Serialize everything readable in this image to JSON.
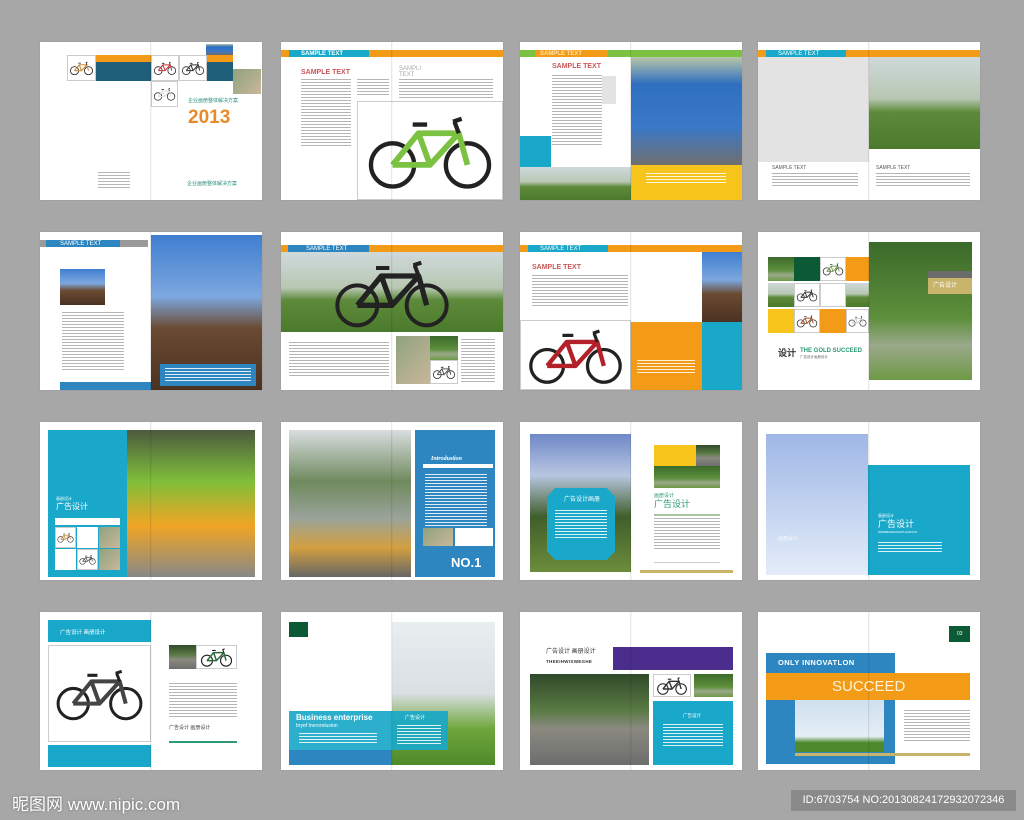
{
  "colors": {
    "cyan": "#19a8c9",
    "orange": "#f39b17",
    "blue": "#2d86c0",
    "green": "#0b5a35",
    "yellow": "#f7c41c",
    "purple": "#4b2d8d",
    "tan": "#c9b46c",
    "background": "#a7a7a7"
  },
  "spreads": [
    {
      "title_cn": "企业画册整体解决方案",
      "year": "2013",
      "footer_cn": "企业画册整体解决方案"
    },
    {
      "tab": "SAMPLE TEXT",
      "heading": "SAMPLE TEXT",
      "heading_right": "SAMPLI TEXT"
    },
    {
      "tab": "SAMPLE TEXT",
      "heading": "SAMPLE TEXT"
    },
    {
      "tab": "SAMPLE TEXT",
      "caption_left": "SAMPLE TEXT",
      "caption_right": "SAMPLE TEXT"
    },
    {
      "tab": "SAMPLE TEXT"
    },
    {
      "tab": "SAMPLE TEXT"
    },
    {
      "tab": "SAMPLE TEXT",
      "heading": "SAMPLE TEXT"
    },
    {
      "title_cn": "设计",
      "title_en": "THE GOLD SUCCEED",
      "subtitle_cn": "广告设计画册设计",
      "label_cn": "广告设计"
    },
    {
      "small_cn": "画册设计",
      "title_cn": "广告设计"
    },
    {
      "heading": "Introdustion",
      "number": "NO.1"
    },
    {
      "box_title": "广告设计画册",
      "small_cn": "画册设计",
      "title_cn": "广告设计"
    },
    {
      "small_cn": "画册设计",
      "title_cn": "广告设计",
      "subtitle_en": "WENBENWAISHITUANXIAN",
      "overlay_cn": "画册设计"
    },
    {
      "header_cn": "广告设计 画册设计",
      "caption_cn": "广告设计 画册设计"
    },
    {
      "title_en": "Business enterprise",
      "subtitle_en": "bryef Ineroreluston",
      "label_cn": "广告设计"
    },
    {
      "title_cn": "广告设计 画册设计",
      "subtitle_en": "THEEIHWISWEGHE",
      "label_cn": "广告设计"
    },
    {
      "title_en": "ONLY INNOVATLON",
      "headline": "SUCCEED",
      "page_number": "03"
    }
  ],
  "watermark": {
    "logo_text": "昵图网 www.nipic.com",
    "id_text": "ID:6703754 NO:20130824172932072346"
  }
}
